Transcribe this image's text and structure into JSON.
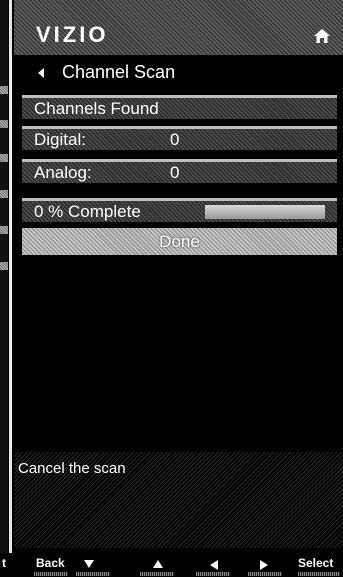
{
  "header": {
    "logo": "VIZIO",
    "home_icon": "home-icon"
  },
  "menu": {
    "title": "Channel Scan",
    "channels_found_label": "Channels Found",
    "digital": {
      "label": "Digital:",
      "value": "0"
    },
    "analog": {
      "label": "Analog:",
      "value": "0"
    },
    "progress": {
      "text": "0 % Complete",
      "percent": 0
    },
    "done_label": "Done"
  },
  "help_text": "Cancel the scan",
  "left_strip_partial": "t",
  "bottom_bar": {
    "back": "Back",
    "down_icon": "down-arrow-icon",
    "up_icon": "up-arrow-icon",
    "left_icon": "left-arrow-icon",
    "right_icon": "right-arrow-icon",
    "select": "Select"
  },
  "colors": {
    "background": "#000000",
    "text": "#ffffff",
    "highlight": "#bdbdbd"
  }
}
